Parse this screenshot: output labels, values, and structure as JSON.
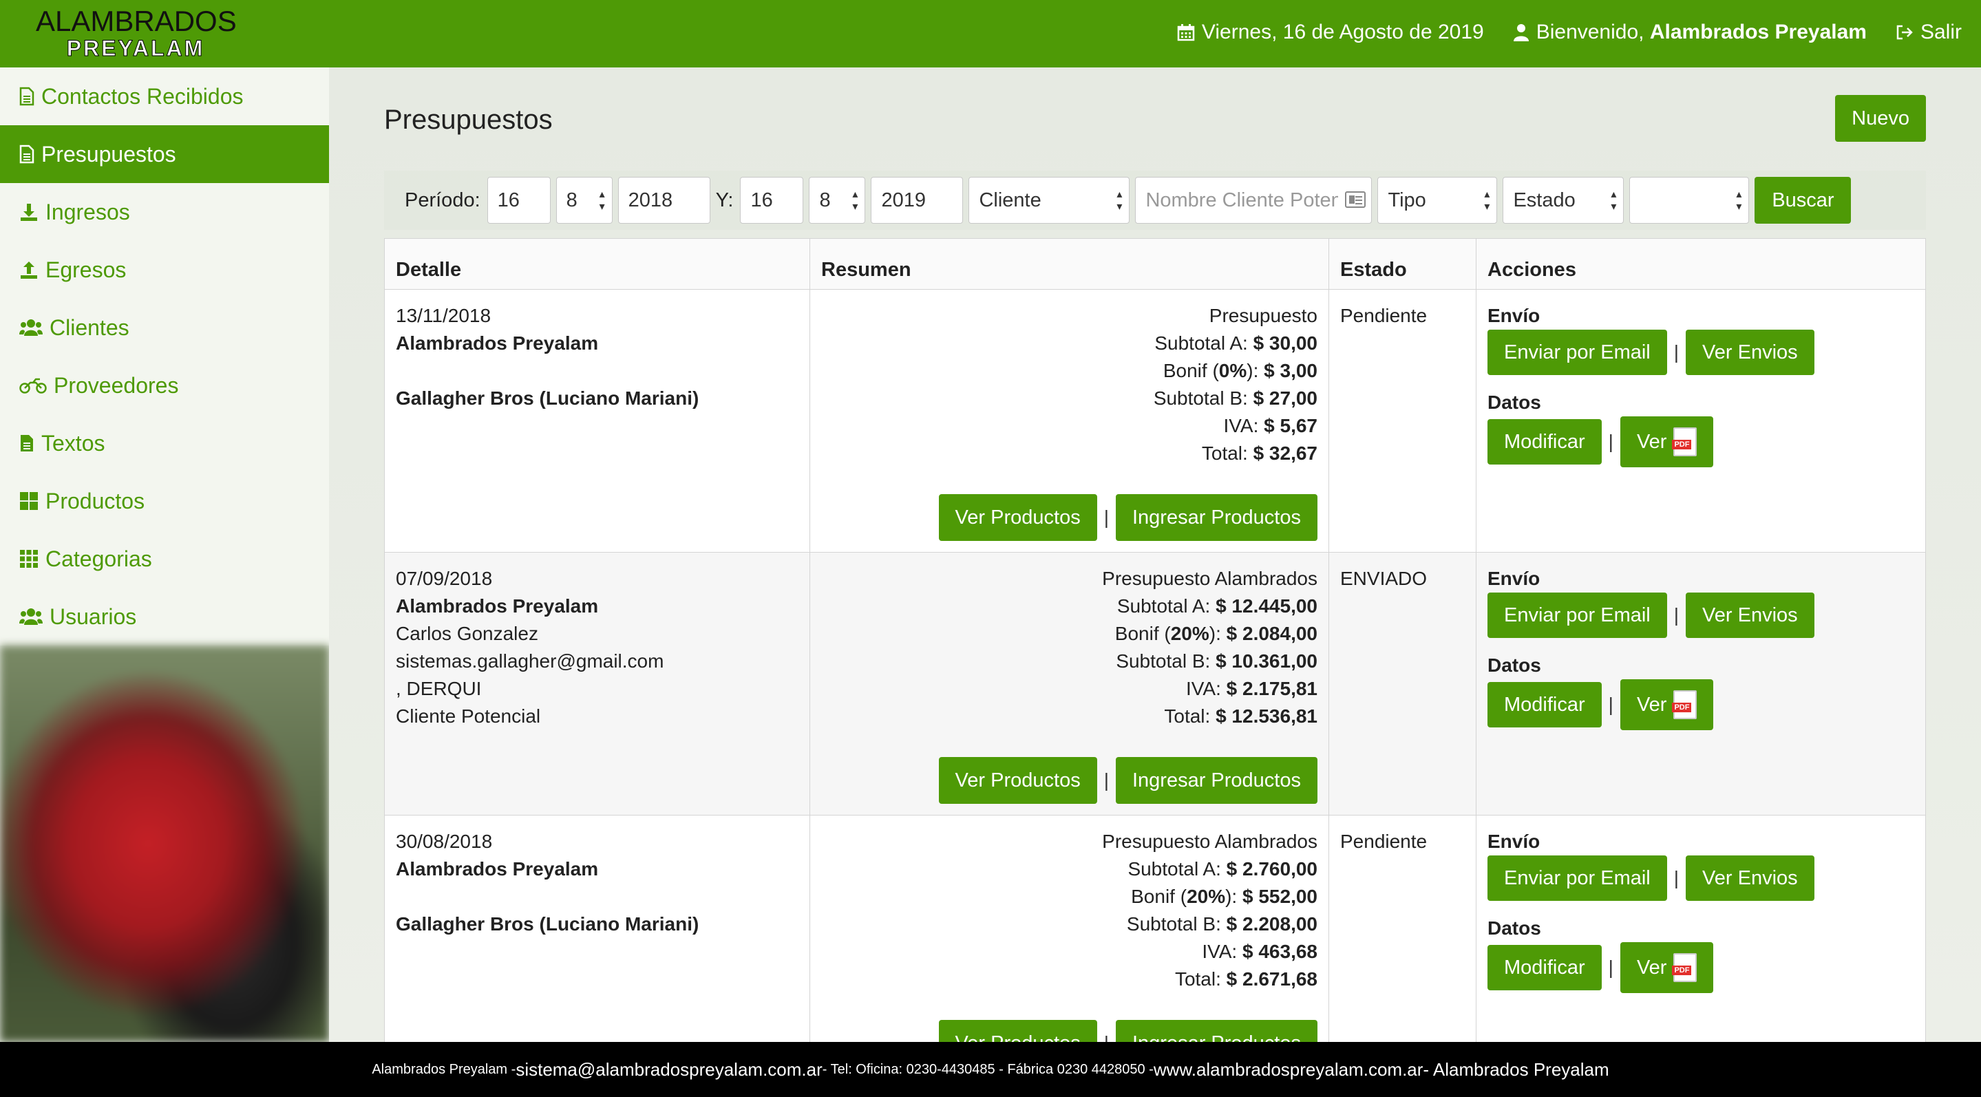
{
  "header": {
    "logo_line1": "ALAMBRADOS",
    "logo_line2": "PREYALAM",
    "date": "Viernes, 16 de Agosto de 2019",
    "welcome_prefix": "Bienvenido, ",
    "welcome_name": "Alambrados Preyalam",
    "logout": "Salir",
    "colors": {
      "primary": "#4e9a06"
    }
  },
  "sidebar": {
    "items": [
      {
        "label": "Contactos Recibidos",
        "icon": "file-icon"
      },
      {
        "label": "Presupuestos",
        "icon": "file-icon",
        "active": true
      },
      {
        "label": "Ingresos",
        "icon": "download-icon"
      },
      {
        "label": "Egresos",
        "icon": "upload-icon"
      },
      {
        "label": "Clientes",
        "icon": "users-icon"
      },
      {
        "label": "Proveedores",
        "icon": "motorcycle-icon"
      },
      {
        "label": "Textos",
        "icon": "file-text-icon"
      },
      {
        "label": "Productos",
        "icon": "grid-large-icon"
      },
      {
        "label": "Categorias",
        "icon": "grid-icon"
      },
      {
        "label": "Usuarios",
        "icon": "users-icon"
      }
    ]
  },
  "main": {
    "title": "Presupuestos",
    "new_button": "Nuevo",
    "filters": {
      "periodo_label": "Período:",
      "from_day": "16",
      "from_month": "8",
      "from_year": "2018",
      "y_label": "Y:",
      "to_day": "16",
      "to_month": "8",
      "to_year": "2019",
      "cliente_select": "Cliente",
      "nombre_placeholder": "Nombre Cliente Potencial",
      "tipo_select": "Tipo",
      "estado_select": "Estado",
      "extra_select": "",
      "search_button": "Buscar"
    },
    "table": {
      "headers": [
        "Detalle",
        "Resumen",
        "Estado",
        "Acciones"
      ],
      "labels": {
        "subtotal_a": "Subtotal A: ",
        "bonif_prefix": "Bonif (",
        "bonif_suffix": "): ",
        "subtotal_b": "Subtotal B: ",
        "iva": "IVA: ",
        "total": "Total: ",
        "ver_productos": "Ver Productos",
        "ingresar_productos": "Ingresar Productos",
        "envio": "Envío",
        "enviar_email": "Enviar por Email",
        "ver_envios": "Ver Envios",
        "datos": "Datos",
        "modificar": "Modificar",
        "ver": "Ver",
        "separator": "|"
      },
      "rows": [
        {
          "date": "13/11/2018",
          "company": "Alambrados Preyalam",
          "client_lines": [
            "",
            "Gallagher Bros (Luciano Mariani)",
            "",
            ""
          ],
          "client_bold": true,
          "type": "Presupuesto",
          "subtotal_a": "$ 30,00",
          "bonif_pct": "0%",
          "bonif": "$ 3,00",
          "subtotal_b": "$ 27,00",
          "iva": "$ 5,67",
          "total": "$ 32,67",
          "estado": "Pendiente"
        },
        {
          "date": "07/09/2018",
          "company": "Alambrados Preyalam",
          "client_lines": [
            "Carlos Gonzalez",
            "sistemas.gallagher@gmail.com",
            ", DERQUI",
            "Cliente Potencial"
          ],
          "client_bold": false,
          "type": "Presupuesto Alambrados",
          "subtotal_a": "$ 12.445,00",
          "bonif_pct": "20%",
          "bonif": "$ 2.084,00",
          "subtotal_b": "$ 10.361,00",
          "iva": "$ 2.175,81",
          "total": "$ 12.536,81",
          "estado": "ENVIADO"
        },
        {
          "date": "30/08/2018",
          "company": "Alambrados Preyalam",
          "client_lines": [
            "",
            "Gallagher Bros (Luciano Mariani)",
            "",
            ""
          ],
          "client_bold": true,
          "type": "Presupuesto Alambrados",
          "subtotal_a": "$ 2.760,00",
          "bonif_pct": "20%",
          "bonif": "$ 552,00",
          "subtotal_b": "$ 2.208,00",
          "iva": "$ 463,68",
          "total": "$ 2.671,68",
          "estado": "Pendiente"
        }
      ]
    }
  },
  "footer": {
    "company": "Alambrados Preyalam - ",
    "email": "sistema@alambradospreyalam.com.ar",
    "phones": " - Tel: Oficina: 0230-4430485 - Fábrica 0230 4428050 - ",
    "website": "www.alambradospreyalam.com.ar",
    "company_end": " - Alambrados Preyalam"
  }
}
